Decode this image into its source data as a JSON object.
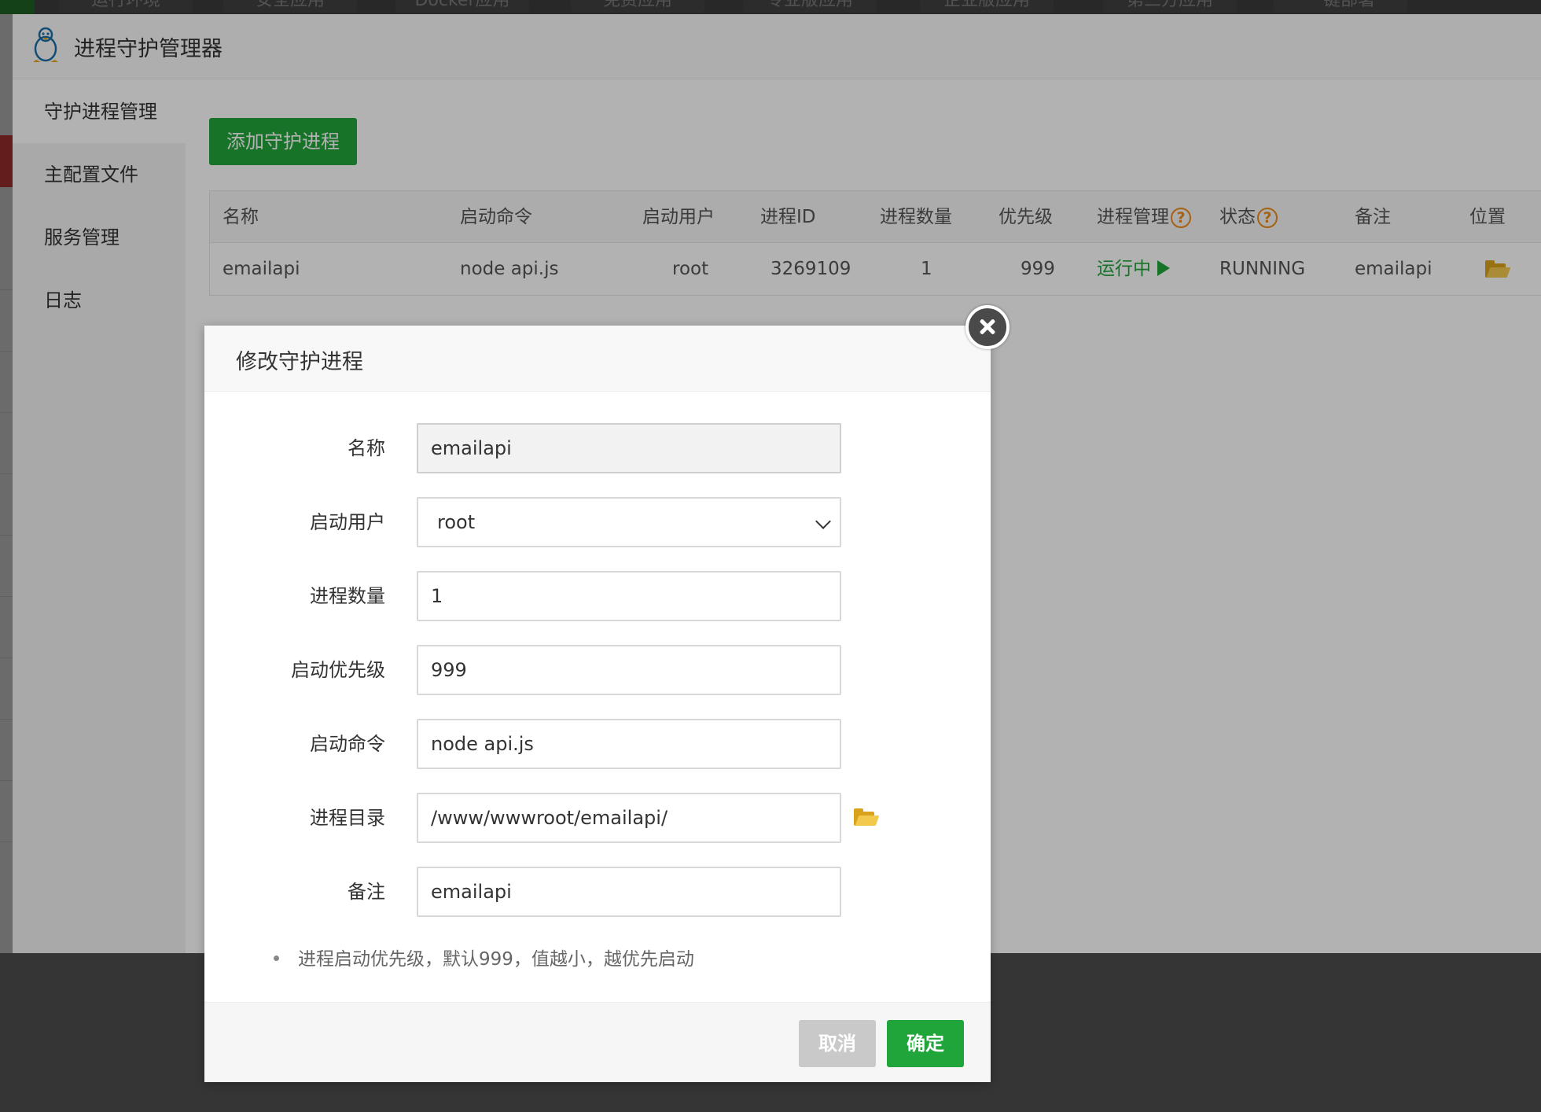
{
  "top_tabs": [
    "运行环境",
    "安全应用",
    "Docker应用",
    "免费应用",
    "专业版应用",
    "企业版应用",
    "第三方应用",
    "一键部署"
  ],
  "window": {
    "title": "进程守护管理器",
    "logo_icon": "penguin-icon"
  },
  "sidebar": {
    "items": [
      {
        "label": "守护进程管理",
        "active": true
      },
      {
        "label": "主配置文件",
        "active": false
      },
      {
        "label": "服务管理",
        "active": false
      },
      {
        "label": "日志",
        "active": false
      }
    ]
  },
  "main": {
    "add_button": "添加守护进程",
    "table": {
      "headers": [
        "名称",
        "启动命令",
        "启动用户",
        "进程ID",
        "进程数量",
        "优先级",
        "进程管理",
        "状态",
        "备注",
        "位置"
      ],
      "help_mark": "?",
      "rows": [
        {
          "name": "emailapi",
          "command": "node api.js",
          "user": "root",
          "pid": "3269109",
          "count": "1",
          "priority": "999",
          "manage": "运行中",
          "status": "RUNNING",
          "note": "emailapi",
          "location_icon": "folder-open-icon"
        }
      ]
    }
  },
  "modal": {
    "title": "修改守护进程",
    "fields": {
      "name": {
        "label": "名称",
        "value": "emailapi"
      },
      "user": {
        "label": "启动用户",
        "value": "root"
      },
      "count": {
        "label": "进程数量",
        "value": "1"
      },
      "priority": {
        "label": "启动优先级",
        "value": "999"
      },
      "command": {
        "label": "启动命令",
        "value": "node api.js"
      },
      "dir": {
        "label": "进程目录",
        "value": "/www/wwwroot/emailapi/"
      },
      "note": {
        "label": "备注",
        "value": "emailapi"
      }
    },
    "tip": "进程启动优先级，默认999，值越小，越优先启动",
    "cancel": "取消",
    "confirm": "确定"
  },
  "colors": {
    "accent_green": "#20a53a",
    "help_orange": "#ef8c1a",
    "folder_yellow": "#f2c94c"
  }
}
